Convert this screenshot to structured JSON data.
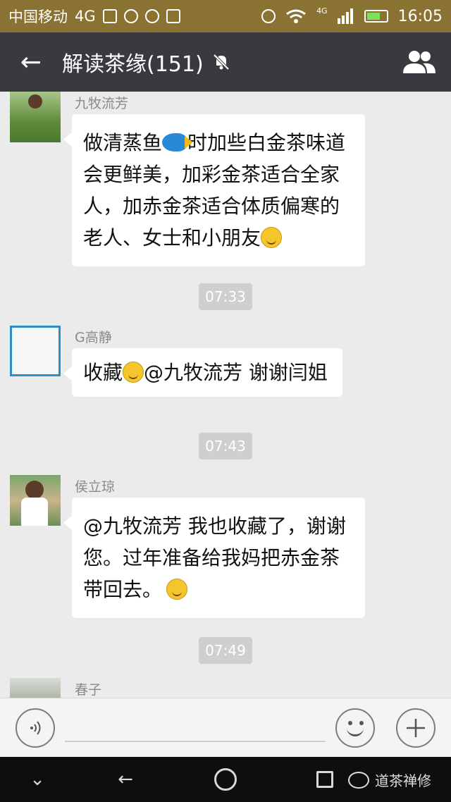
{
  "status_bar": {
    "carrier": "中国移动",
    "network": "4G",
    "signal_label": "4G",
    "time": "16:05",
    "icons": [
      "image-icon",
      "android-icon",
      "shield-icon",
      "download-icon",
      "alarm-icon",
      "wifi-icon",
      "signal-icon",
      "battery-icon"
    ]
  },
  "header": {
    "back_icon": "←",
    "title": "解读茶缘(151)",
    "mute_icon": "bell-off-icon",
    "group_icon": "group-icon"
  },
  "messages": [
    {
      "sender": "九牧流芳",
      "avatar": "tea-garden-photo",
      "lines": [
        "做清蒸鱼",
        "时加些白金茶味道",
        "会更鲜美，加彩金茶适合全家",
        "人，加赤金茶适合体质偏寒的",
        "老人、女士和小朋友"
      ]
    },
    {
      "time": "07:33"
    },
    {
      "sender": "G高静",
      "avatar": "white-square-photo",
      "lines": [
        "收藏",
        "@九牧流芳 谢谢闫姐"
      ]
    },
    {
      "time": "07:43"
    },
    {
      "sender": "侯立琼",
      "avatar": "child-photo",
      "lines": [
        "@九牧流芳 我也收藏了，谢谢",
        "您。过年准备给我妈把赤金茶",
        "带回去。"
      ]
    },
    {
      "time": "07:49"
    },
    {
      "sender": "春子",
      "avatar": "tree-photo"
    }
  ],
  "input_bar": {
    "voice_icon": "voice-icon",
    "emoji_icon": "smiley-icon",
    "plus_icon": "plus-icon"
  },
  "nav_bar": {
    "down_icon": "⌄",
    "back_icon": "←",
    "watermark": "道茶禅修"
  }
}
